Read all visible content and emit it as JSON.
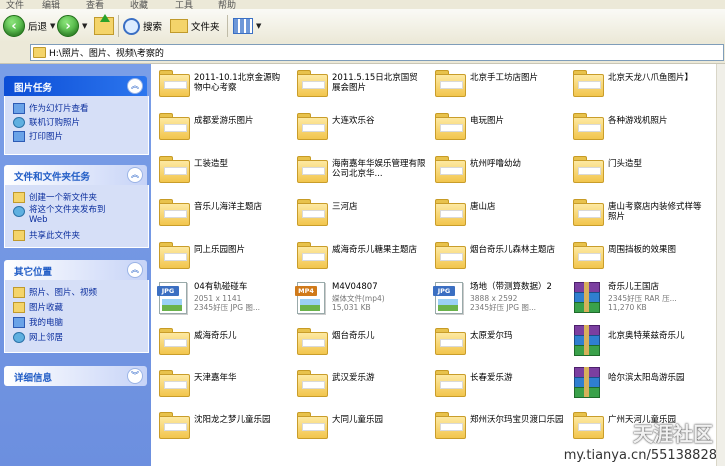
{
  "menubar": [
    "文件",
    "编辑",
    "查看",
    "收藏",
    "工具",
    "帮助"
  ],
  "toolbar": {
    "back_label": "后退",
    "search_label": "搜索",
    "folders_label": "文件夹"
  },
  "address": {
    "path": "H:\\照片、图片、视频\\考察的"
  },
  "sidebar": {
    "picture_tasks": {
      "title": "图片任务",
      "items": [
        "作为幻灯片查看",
        "联机订购照片",
        "打印图片"
      ]
    },
    "file_tasks": {
      "title": "文件和文件夹任务",
      "items": [
        "创建一个新文件夹",
        "将这个文件夹发布到 Web",
        "共享此文件夹"
      ]
    },
    "other_places": {
      "title": "其它位置",
      "items": [
        "照片、图片、视频",
        "图片收藏",
        "我的电脑",
        "网上邻居"
      ]
    },
    "details": {
      "title": "详细信息"
    }
  },
  "items": [
    {
      "name": "2011-10.1北京金源购物中心考察",
      "type": "folder"
    },
    {
      "name": "2011.5.15日北京国贸展会图片",
      "type": "folder"
    },
    {
      "name": "北京手工坊店图片",
      "type": "folder"
    },
    {
      "name": "北京天龙八爪鱼图片】",
      "type": "folder"
    },
    {
      "name": "成都爱游乐图片",
      "type": "folder"
    },
    {
      "name": "大连欢乐谷",
      "type": "folder"
    },
    {
      "name": "电玩图片",
      "type": "folder"
    },
    {
      "name": "各种游戏机照片",
      "type": "folder"
    },
    {
      "name": "工装造型",
      "type": "folder"
    },
    {
      "name": "海南嘉年华娱乐管理有限公司北京华...",
      "type": "folder"
    },
    {
      "name": "杭州呼噜幼幼",
      "type": "folder"
    },
    {
      "name": "门头造型",
      "type": "folder"
    },
    {
      "name": "音乐儿海洋主题店",
      "type": "folder"
    },
    {
      "name": "三河店",
      "type": "folder"
    },
    {
      "name": "唐山店",
      "type": "folder"
    },
    {
      "name": "唐山考察店内装修式样等照片",
      "type": "folder"
    },
    {
      "name": "同上乐园图片",
      "type": "folder"
    },
    {
      "name": "威海奇乐儿糖果主题店",
      "type": "folder"
    },
    {
      "name": "烟台奇乐儿森林主题店",
      "type": "folder"
    },
    {
      "name": "周围挡板的效果图",
      "type": "folder"
    },
    {
      "name": "04有轨碰碰车",
      "type": "jpg",
      "badge": "JPG",
      "meta1": "2051 x 1141",
      "meta2": "2345好压 JPG 图..."
    },
    {
      "name": "M4V04807",
      "type": "mp4",
      "badge": "MP4",
      "meta1": "媒体文件(mp4)",
      "meta2": "15,031 KB"
    },
    {
      "name": "场地（带测算数据）2",
      "type": "jpg",
      "badge": "JPG",
      "meta1": "3888 x 2592",
      "meta2": "2345好压 JPG 图..."
    },
    {
      "name": "奇乐儿王国店",
      "type": "rar",
      "meta1": "2345好压 RAR 压...",
      "meta2": "11,270 KB"
    },
    {
      "name": "威海奇乐儿",
      "type": "folder"
    },
    {
      "name": "烟台奇乐儿",
      "type": "folder"
    },
    {
      "name": "太原爱尔玛",
      "type": "folder"
    },
    {
      "name": "北京奥特莱兹奇乐儿",
      "type": "rar"
    },
    {
      "name": "天津嘉年华",
      "type": "folder"
    },
    {
      "name": "武汉爱乐游",
      "type": "folder"
    },
    {
      "name": "长春爱乐游",
      "type": "folder"
    },
    {
      "name": "哈尔滨太阳岛游乐园",
      "type": "rar"
    },
    {
      "name": "沈阳龙之梦儿童乐园",
      "type": "folder"
    },
    {
      "name": "大同儿童乐园",
      "type": "folder"
    },
    {
      "name": "郑州沃尔玛宝贝渡口乐园",
      "type": "folder"
    },
    {
      "name": "广州天河儿童乐园",
      "type": "folder"
    }
  ],
  "watermark": {
    "site": "天涯社区",
    "url": "my.tianya.cn/55138828"
  }
}
